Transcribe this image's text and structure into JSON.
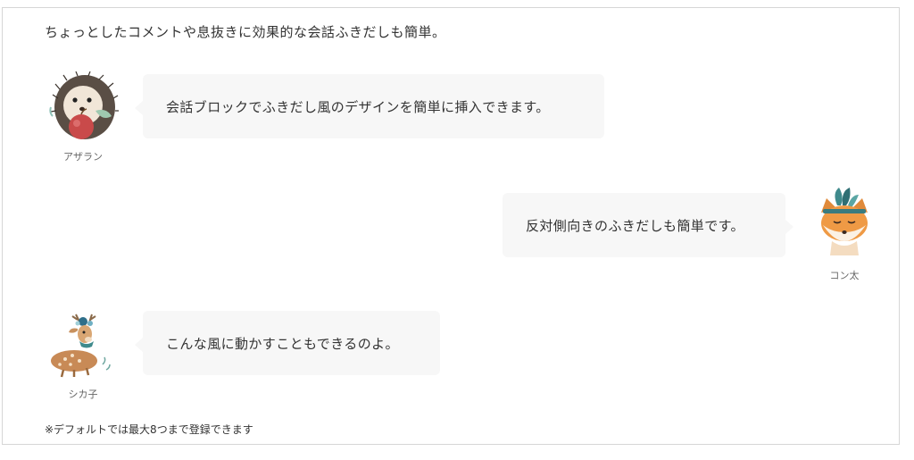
{
  "intro_text": "ちょっとしたコメントや息抜きに効果的な会話ふきだしも簡単。",
  "conversations": [
    {
      "speaker": "アザラン",
      "avatar_icon": "hedgehog-with-apple-icon",
      "text": "会話ブロックでふきだし風のデザインを簡単に挿入できます。",
      "side": "left"
    },
    {
      "speaker": "コン太",
      "avatar_icon": "fox-with-feathers-icon",
      "text": "反対側向きのふきだしも簡単です。",
      "side": "right"
    },
    {
      "speaker": "シカ子",
      "avatar_icon": "deer-with-flowers-icon",
      "text": "こんな風に動かすこともできるのよ。",
      "side": "left"
    }
  ],
  "footnote": "※デフォルトでは最大8つまで登録できます",
  "colors": {
    "bubble_bg": "#f7f7f7",
    "frame_border": "#d6d6d6",
    "text": "#333333"
  }
}
